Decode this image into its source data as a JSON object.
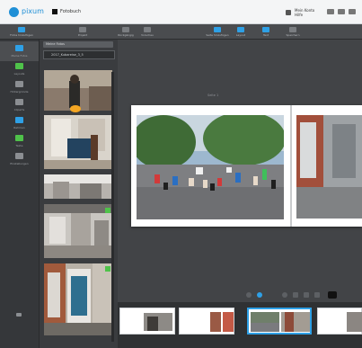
{
  "header": {
    "logo_text": "pixum",
    "breadcrumb": "Fotobuch",
    "account_line1": "Mein Konto",
    "account_line2": "Hilfe"
  },
  "toolbar": {
    "items": [
      {
        "label": "Fotos hinzufügen",
        "icon": "add-photos-icon"
      },
      {
        "label": "Projekt",
        "icon": "project-icon"
      },
      {
        "label": "Rückgängig",
        "icon": "undo-icon"
      },
      {
        "label": "Vorschau",
        "icon": "preview-icon"
      },
      {
        "label": "Seite hinzufügen",
        "icon": "add-page-icon"
      },
      {
        "label": "Layout",
        "icon": "layout-icon"
      },
      {
        "label": "Text",
        "icon": "text-icon"
      },
      {
        "label": "Speichern",
        "icon": "save-icon"
      }
    ]
  },
  "sidebar": {
    "items": [
      {
        "label": "Meine Fotos",
        "icon": "photos-icon"
      },
      {
        "label": "Layouts",
        "icon": "layouts-icon"
      },
      {
        "label": "Hintergründe",
        "icon": "backgrounds-icon"
      },
      {
        "label": "Cliparts",
        "icon": "cliparts-icon"
      },
      {
        "label": "Rahmen",
        "icon": "frames-icon"
      },
      {
        "label": "Texte",
        "icon": "texts-icon"
      },
      {
        "label": "Einstellungen",
        "icon": "settings-icon"
      }
    ]
  },
  "panel": {
    "header": "Meine Fotos",
    "folder": "2017_Kubareise_3_5"
  },
  "canvas": {
    "page_label": "Seite 1"
  },
  "colors": {
    "accent": "#2ea0e6",
    "green": "#4fc24a",
    "dark_bg": "#3e4043"
  }
}
